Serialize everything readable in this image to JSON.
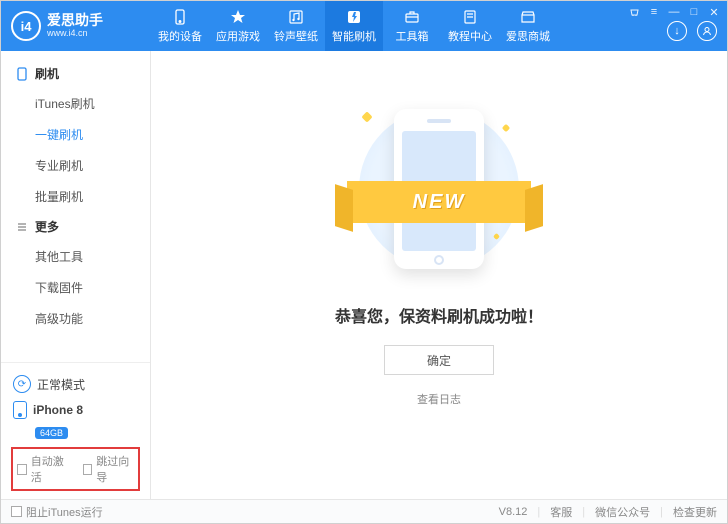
{
  "brand": {
    "name": "爱思助手",
    "url": "www.i4.cn",
    "logo_text": "i4"
  },
  "win": {
    "shop": "⌂",
    "menu": "≡",
    "min": "—",
    "max": "□",
    "close": "✕"
  },
  "tabs": [
    {
      "label": "我的设备",
      "icon": "device"
    },
    {
      "label": "应用游戏",
      "icon": "apps"
    },
    {
      "label": "铃声壁纸",
      "icon": "music"
    },
    {
      "label": "智能刷机",
      "icon": "flash",
      "active": true
    },
    {
      "label": "工具箱",
      "icon": "toolbox"
    },
    {
      "label": "教程中心",
      "icon": "book"
    },
    {
      "label": "爱思商城",
      "icon": "store"
    }
  ],
  "sidebar": {
    "group1": {
      "title": "刷机"
    },
    "items1": [
      {
        "label": "iTunes刷机"
      },
      {
        "label": "一键刷机",
        "active": true
      },
      {
        "label": "专业刷机"
      },
      {
        "label": "批量刷机"
      }
    ],
    "group2": {
      "title": "更多"
    },
    "items2": [
      {
        "label": "其他工具"
      },
      {
        "label": "下载固件"
      },
      {
        "label": "高级功能"
      }
    ],
    "mode": "正常模式",
    "device": {
      "name": "iPhone 8",
      "storage": "64GB"
    },
    "checks": {
      "auto_activate": "自动激活",
      "skip_guide": "跳过向导"
    }
  },
  "main": {
    "ribbon": "NEW",
    "message": "恭喜您，保资料刷机成功啦！",
    "ok": "确定",
    "log": "查看日志"
  },
  "footer": {
    "block_itunes": "阻止iTunes运行",
    "version": "V8.12",
    "links": [
      "客服",
      "微信公众号",
      "检查更新"
    ]
  }
}
